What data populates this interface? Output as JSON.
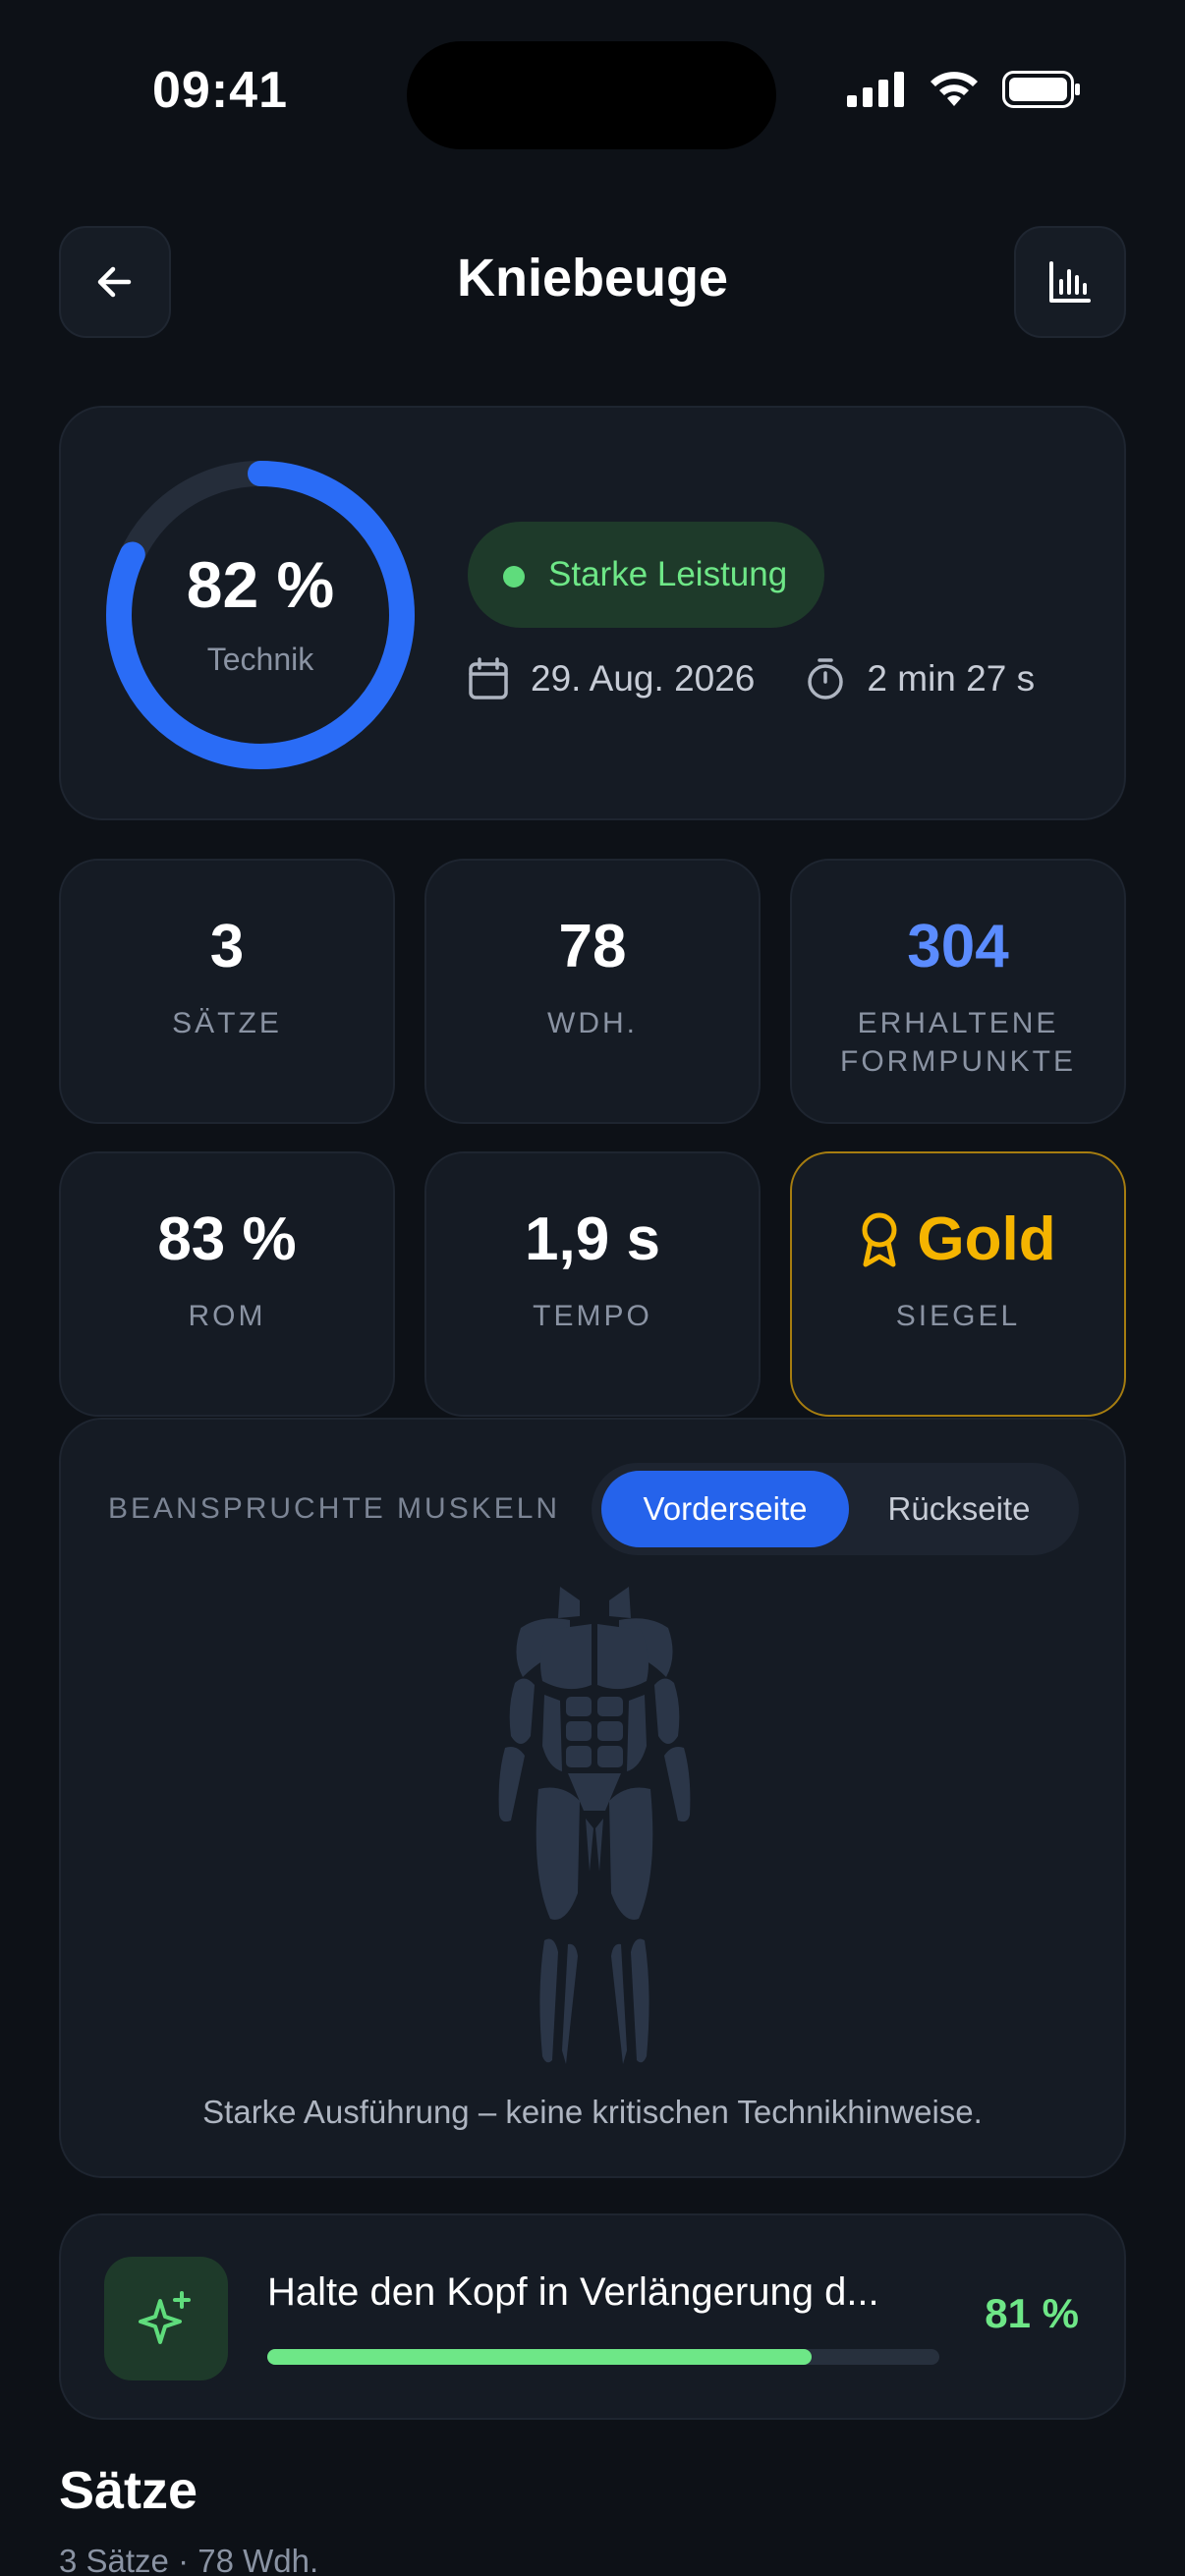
{
  "status_bar": {
    "time": "09:41"
  },
  "header": {
    "title": "Kniebeuge"
  },
  "score": {
    "percent_label": "82 %",
    "technique_fraction": 0.82,
    "label": "Technik",
    "badge": "Starke Leistung",
    "date": "29. Aug. 2026",
    "duration": "2 min 27 s"
  },
  "stats": [
    {
      "value": "3",
      "label": "SÄTZE"
    },
    {
      "value": "78",
      "label": "WDH."
    },
    {
      "value": "304",
      "label": "ERHALTENE FORMPUNKTE"
    },
    {
      "value": "83 %",
      "label": "ROM"
    },
    {
      "value": "1,9 s",
      "label": "TEMPO"
    },
    {
      "value": "Gold",
      "label": "SIEGEL"
    }
  ],
  "muscles": {
    "title": "BEANSPRUCHTE MUSKELN",
    "tab_front": "Vorderseite",
    "tab_back": "Rückseite",
    "selected_tab": "Vorderseite",
    "note": "Starke Ausführung – keine kritischen Technikhinweise."
  },
  "tip": {
    "text": "Halte den Kopf in Verlängerung d...",
    "percent_label": "81 %",
    "progress_fraction": 0.81
  },
  "sets": {
    "title": "Sätze",
    "subtitle": "3 Sätze · 78 Wdh."
  },
  "colors": {
    "accent_blue": "#2563eb",
    "success_green": "#6ee787",
    "gold": "#f5b400",
    "background": "#0d1117",
    "card": "#151b24"
  }
}
